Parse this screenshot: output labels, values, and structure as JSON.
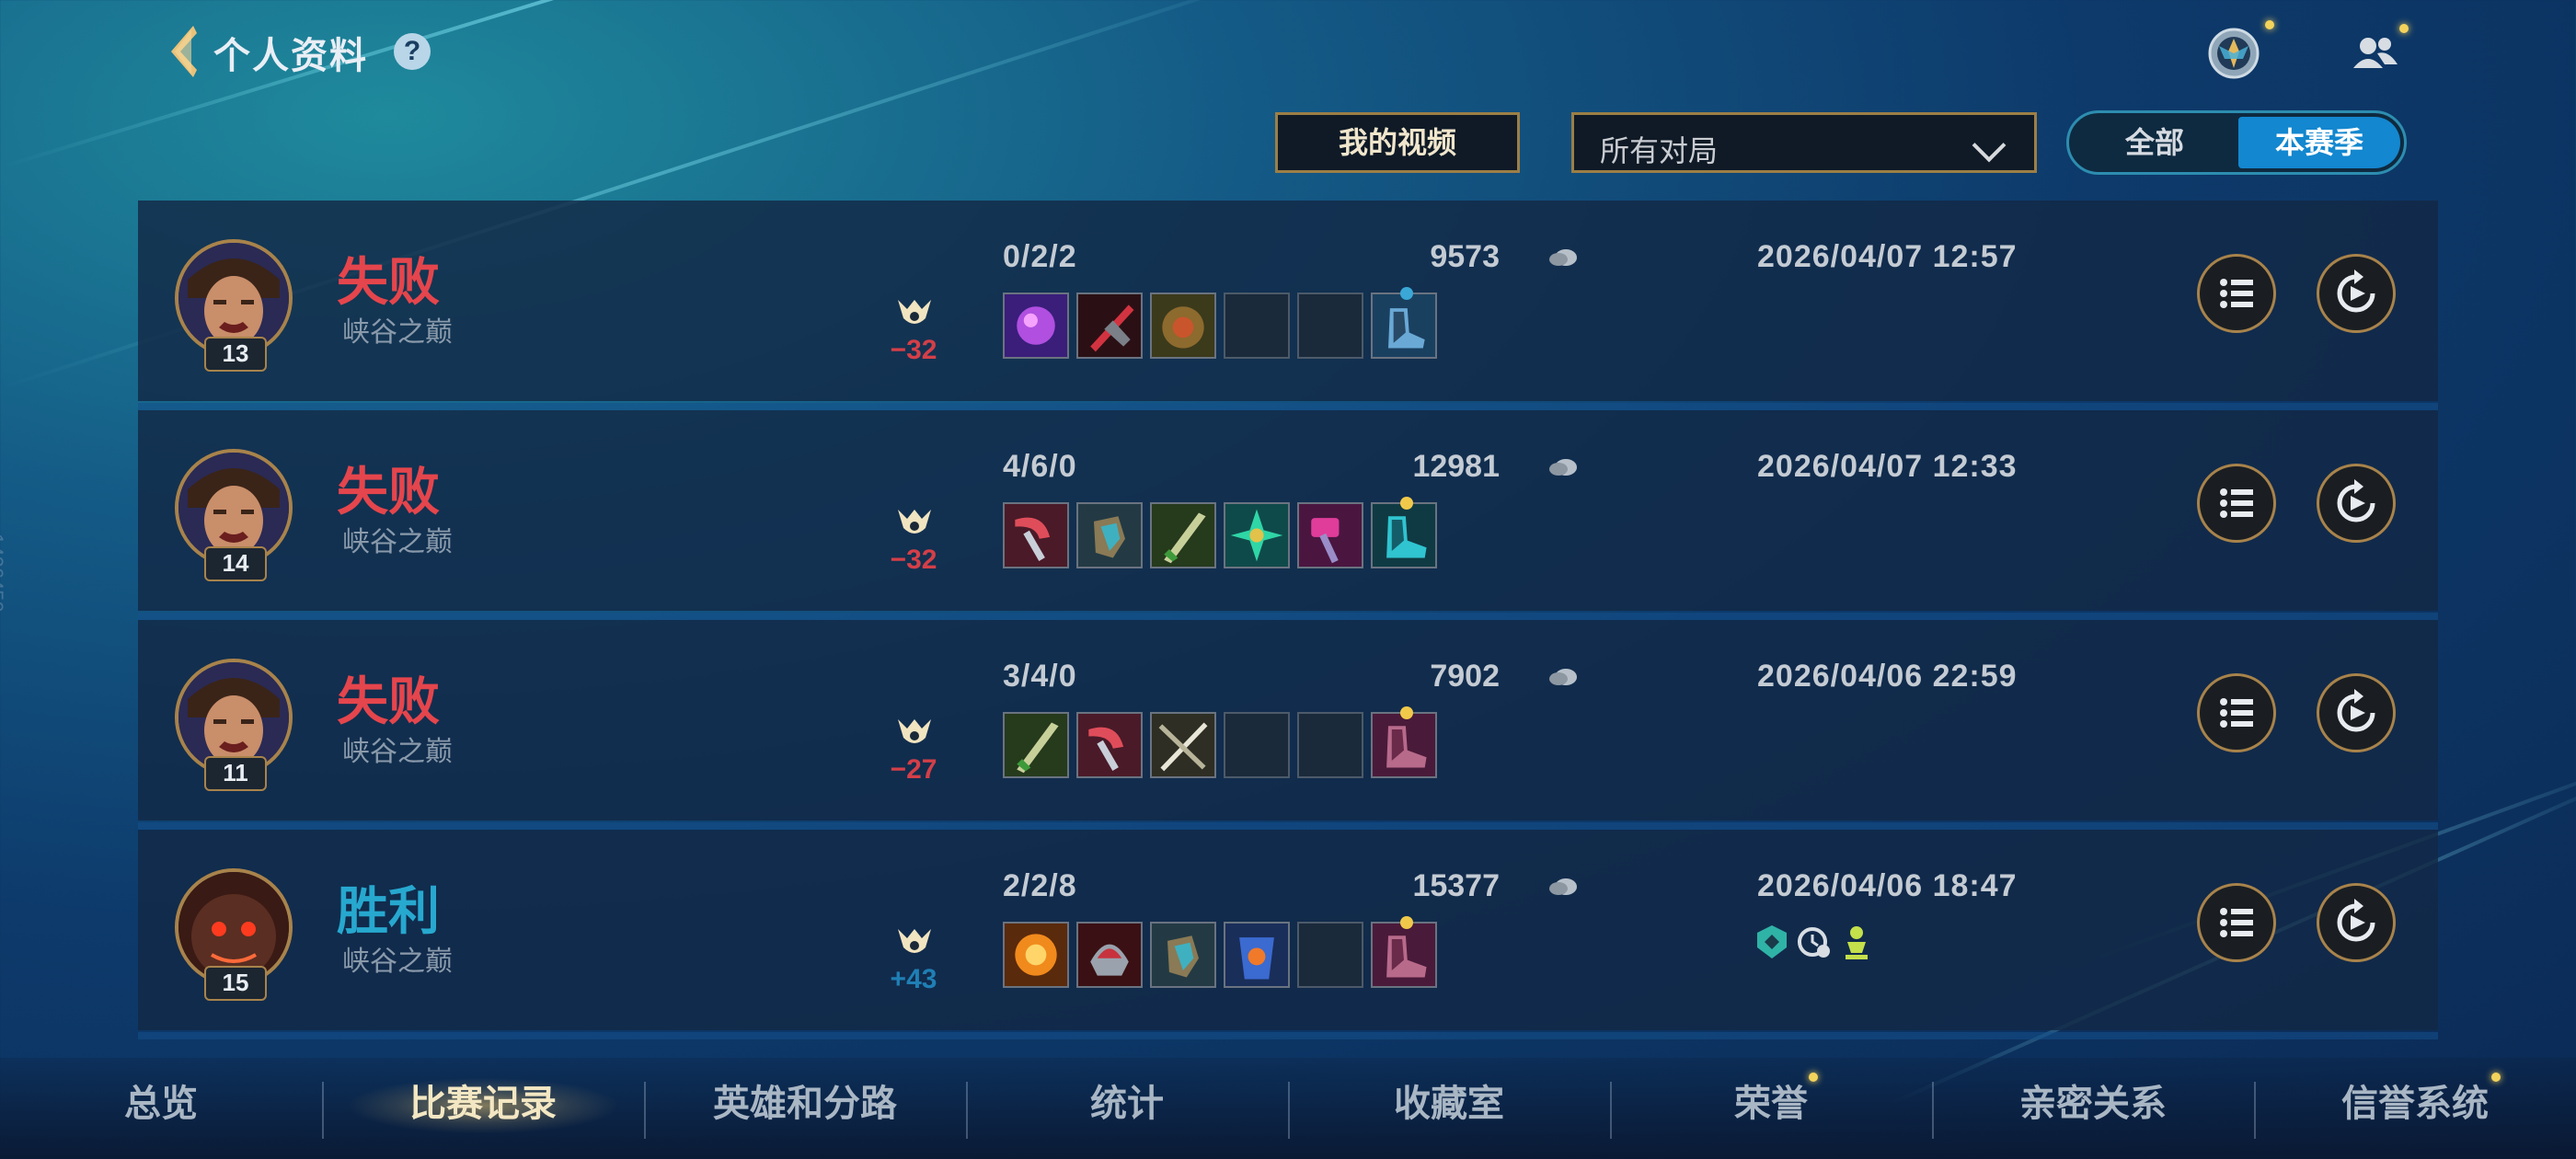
{
  "header": {
    "title": "个人资料",
    "help_label": "?"
  },
  "controls": {
    "video_button": "我的视频",
    "filter_value": "所有对局",
    "toggle_all": "全部",
    "toggle_season": "本赛季",
    "toggle_selected": "本赛季"
  },
  "matches": [
    {
      "result": "失败",
      "result_type": "lose",
      "mode": "峡谷之巅",
      "level": "13",
      "lp": "−32",
      "kda": "0/2/2",
      "gold": "9573",
      "datetime": "2026/04/07 12:57",
      "items": [
        "violet-orb",
        "crimson-blade",
        "bronze-shield",
        "empty",
        "empty",
        "blue-boots"
      ],
      "ward_color": "#3aa7d6"
    },
    {
      "result": "失败",
      "result_type": "lose",
      "mode": "峡谷之巅",
      "level": "14",
      "lp": "−32",
      "kda": "4/6/0",
      "gold": "12981",
      "datetime": "2026/04/07 12:33",
      "items": [
        "red-axe",
        "gauntlet",
        "green-sword",
        "emerald-cross",
        "magenta-hammer",
        "teal-boots"
      ],
      "ward_color": "#f1c94a"
    },
    {
      "result": "失败",
      "result_type": "lose",
      "mode": "峡谷之巅",
      "level": "11",
      "lp": "−27",
      "kda": "3/4/0",
      "gold": "7902",
      "datetime": "2026/04/06 22:59",
      "items": [
        "green-sword",
        "red-axe",
        "pale-blades",
        "empty",
        "empty",
        "magenta-boots"
      ],
      "ward_color": "#f1c94a"
    },
    {
      "result": "胜利",
      "result_type": "win",
      "mode": "峡谷之巅",
      "level": "15",
      "lp": "+43",
      "kda": "2/2/8",
      "gold": "15377",
      "datetime": "2026/04/06 18:47",
      "items": [
        "fire-orb",
        "crimson-helm",
        "gauntlet",
        "blue-fire-armor",
        "empty",
        "magenta-boots"
      ],
      "ward_color": "#f1c94a",
      "badges": [
        "shield-badge-icon",
        "clock-badge-icon",
        "trophy-badge-icon"
      ]
    }
  ],
  "nav": {
    "tabs": [
      "总览",
      "比赛记录",
      "英雄和分路",
      "统计",
      "收藏室",
      "荣誉",
      "亲密关系",
      "信誉系统"
    ],
    "active": "比赛记录"
  },
  "side_id": "1426450",
  "colors": {
    "lose": "#e5454c",
    "win": "#27a8cf",
    "gold_border": "#a8834b"
  }
}
